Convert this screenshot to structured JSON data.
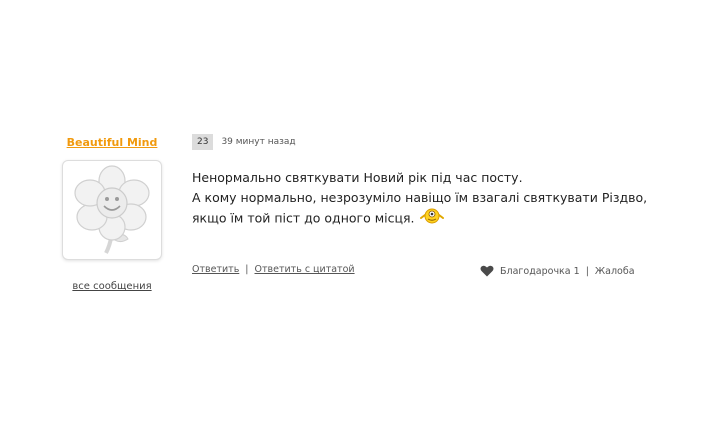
{
  "author": {
    "name": "Beautiful Mind",
    "all_messages_label": "все сообщения"
  },
  "post": {
    "number": "23",
    "time": "39 минут назад",
    "lines": [
      "Ненормально святкувати Новий рік під час посту.",
      "А кому нормально, незрозуміло навіщо їм взагалі святкувати Різдво,",
      "якщо їм той піст до одного місця."
    ]
  },
  "actions": {
    "reply_label": "Ответить",
    "reply_quote_label": "Ответить с цитатой",
    "thanks_label": "Благодарочка 1",
    "complaint_label": "Жалоба",
    "separator": "|"
  },
  "colors": {
    "author_accent": "#f19a0e",
    "badge_bg": "#dcdcdc",
    "text": "#222222"
  },
  "icons": {
    "avatar": "white-flower-avatar",
    "smiley": "yellow-smiley-icon",
    "thanks": "heart-icon"
  }
}
